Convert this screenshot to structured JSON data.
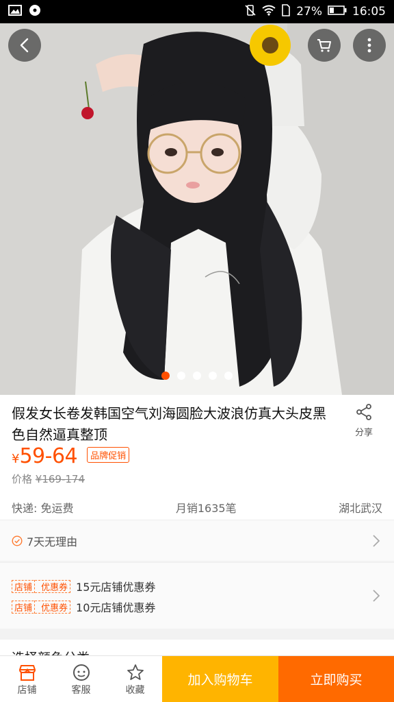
{
  "status_bar": {
    "battery": "27%",
    "time": "16:05"
  },
  "product": {
    "title": "假发女长卷发韩国空气刘海圆脸大波浪仿真大头皮黑色自然逼真整顶",
    "currency": "¥",
    "price": "59-64",
    "promo_badge": "品牌促销",
    "original_price_label": "价格",
    "original_price": "¥169-174",
    "shipping": "快递: 免运费",
    "monthly_sales": "月销1635笔",
    "location": "湖北武汉"
  },
  "share_label": "分享",
  "gallery": {
    "total_images": 5,
    "active_index": 0
  },
  "guarantee": {
    "text": "7天无理由"
  },
  "coupons": [
    {
      "tag_left": "店铺",
      "tag_right": "优惠券",
      "text": "15元店铺优惠券"
    },
    {
      "tag_left": "店铺",
      "tag_right": "优惠券",
      "text": "10元店铺优惠券"
    }
  ],
  "sku_selector": {
    "text": "选择颜色分类"
  },
  "bottom_bar": {
    "shop": "店铺",
    "service": "客服",
    "favorite": "收藏",
    "add_to_cart": "加入购物车",
    "buy_now": "立即购买"
  },
  "colors": {
    "accent": "#ff5000",
    "cart_button": "#ffb400",
    "buy_button": "#ff6a00"
  },
  "icons": [
    "back-icon",
    "cart-icon",
    "more-icon",
    "share-icon",
    "check-circle-icon",
    "chevron-right-icon",
    "shop-icon",
    "service-icon",
    "star-icon"
  ]
}
